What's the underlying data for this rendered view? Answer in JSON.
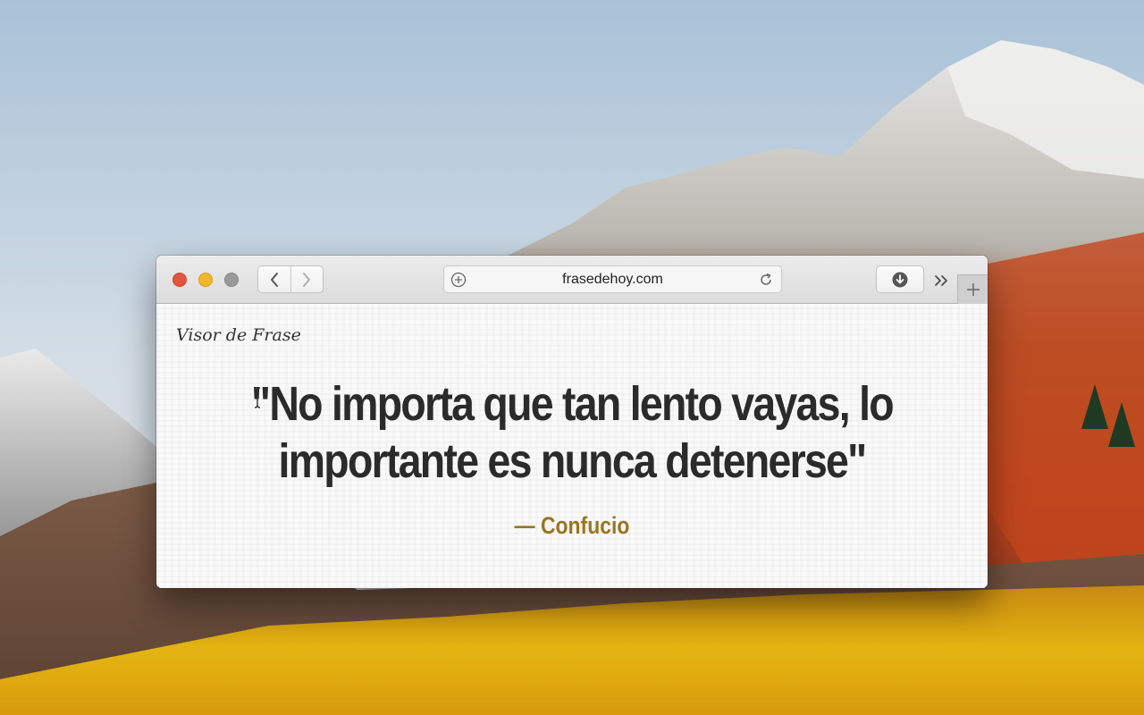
{
  "browser": {
    "address_bar": {
      "url": "frasedehoy.com"
    },
    "icons": {
      "back": "chevron-left-icon",
      "forward": "chevron-right-icon",
      "page_menu": "add-circle-icon",
      "reload": "reload-icon",
      "downloads": "download-icon",
      "more": "double-chevron-right-icon",
      "new_tab": "plus-icon"
    },
    "traffic_lights": {
      "close_color": "#e0563f",
      "minimize_color": "#f2b72b",
      "maximize_color": "#9a9a9a"
    }
  },
  "page": {
    "site_title": "Visor de Frase",
    "quote": "\"No importa que tan lento vayas, lo importante es nunca detenerse\"",
    "author": "— Confucio",
    "colors": {
      "quote_text": "#2b2b2b",
      "author_text": "#9a7421"
    }
  }
}
